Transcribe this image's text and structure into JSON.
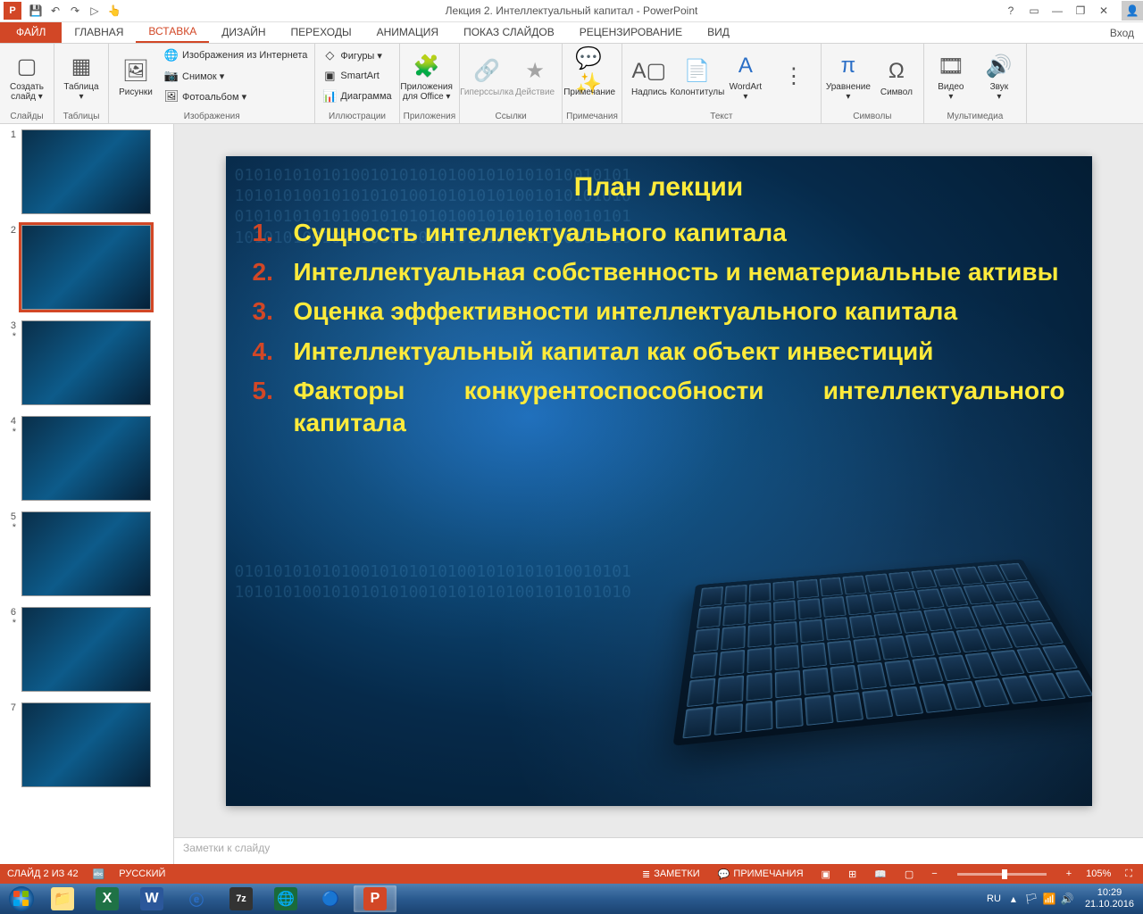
{
  "title": "Лекция 2. Интеллектуальный капитал - PowerPoint",
  "qat": {
    "save": "💾",
    "undo": "↶",
    "redo": "↷",
    "start": "▷",
    "touch": "👆"
  },
  "win": {
    "help": "?",
    "opts": "▭",
    "min": "—",
    "restore": "❐",
    "close": "✕"
  },
  "tabs": {
    "file": "ФАЙЛ",
    "items": [
      "ГЛАВНАЯ",
      "ВСТАВКА",
      "ДИЗАЙН",
      "ПЕРЕХОДЫ",
      "АНИМАЦИЯ",
      "ПОКАЗ СЛАЙДОВ",
      "РЕЦЕНЗИРОВАНИЕ",
      "ВИД"
    ],
    "active_index": 1,
    "login": "Вход"
  },
  "ribbon": {
    "groups": [
      {
        "name": "Слайды",
        "big": [
          {
            "icon": "▢",
            "label": "Создать\nслайд ▾"
          }
        ]
      },
      {
        "name": "Таблицы",
        "big": [
          {
            "icon": "▦",
            "label": "Таблица\n▾"
          }
        ]
      },
      {
        "name": "Изображения",
        "big": [
          {
            "icon": "🖼",
            "label": "Рисунки"
          }
        ],
        "small": [
          {
            "icon": "🌐",
            "label": "Изображения из Интернета"
          },
          {
            "icon": "📷",
            "label": "Снимок ▾"
          },
          {
            "icon": "🖼",
            "label": "Фотоальбом ▾"
          }
        ]
      },
      {
        "name": "Иллюстрации",
        "small": [
          {
            "icon": "◇",
            "label": "Фигуры ▾"
          },
          {
            "icon": "▣",
            "label": "SmartArt"
          },
          {
            "icon": "📊",
            "label": "Диаграмма"
          }
        ]
      },
      {
        "name": "Приложения",
        "big": [
          {
            "icon": "🧩",
            "label": "Приложения\nдля Office ▾"
          }
        ]
      },
      {
        "name": "Ссылки",
        "big": [
          {
            "icon": "🔗",
            "label": "Гиперссылка",
            "disabled": true
          },
          {
            "icon": "★",
            "label": "Действие",
            "disabled": true
          }
        ]
      },
      {
        "name": "Примечания",
        "big": [
          {
            "icon": "💬✨",
            "label": "Примечание"
          }
        ]
      },
      {
        "name": "Текст",
        "big": [
          {
            "icon": "A▢",
            "label": "Надпись"
          },
          {
            "icon": "📄",
            "label": "Колонтитулы"
          },
          {
            "icon": "A",
            "label": "WordArt\n▾",
            "color": "#2a6ec6"
          },
          {
            "icon": "⋮",
            "label": ""
          }
        ]
      },
      {
        "name": "Символы",
        "big": [
          {
            "icon": "π",
            "label": "Уравнение\n▾",
            "color": "#2a6ec6"
          },
          {
            "icon": "Ω",
            "label": "Символ"
          }
        ]
      },
      {
        "name": "Мультимедиа",
        "big": [
          {
            "icon": "🎞",
            "label": "Видео\n▾"
          },
          {
            "icon": "🔊",
            "label": "Звук\n▾"
          }
        ]
      }
    ]
  },
  "thumbnails": {
    "count": 7,
    "active": 2
  },
  "slide": {
    "title": "План лекции",
    "items": [
      {
        "num": "1.",
        "text": "Сущность интеллектуального капитала"
      },
      {
        "num": "2.",
        "text": "Интеллектуальная собственность и нематериальные активы"
      },
      {
        "num": "3.",
        "text": "Оценка эффективности интеллектуального капитала"
      },
      {
        "num": "4.",
        "text": "Интеллектуальный капитал как объект инвестиций"
      },
      {
        "num": "5.",
        "text": "Факторы конкурентоспособности интеллектуального капитала"
      }
    ]
  },
  "notes_placeholder": "Заметки к слайду",
  "status": {
    "slide": "СЛАЙД 2 ИЗ 42",
    "lang": "РУССКИЙ",
    "notes_btn": "ЗАМЕТКИ",
    "comments_btn": "ПРИМЕЧАНИЯ",
    "zoom": "105%"
  },
  "taskbar": {
    "lang": "RU",
    "time": "10:29",
    "date": "21.10.2016"
  }
}
